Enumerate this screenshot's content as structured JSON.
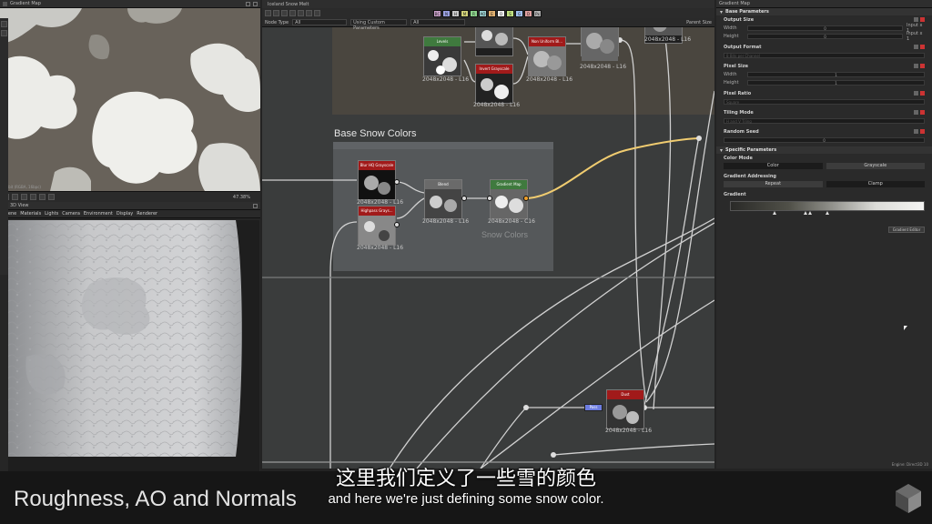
{
  "left_top_panel": {
    "title": "Gradient Map",
    "status": "16bit (RGBA, 16bpc)",
    "zoom": "47.38%"
  },
  "view3d": {
    "title": "3D View",
    "menu": [
      "Scene",
      "Materials",
      "Lights",
      "Camera",
      "Environment",
      "Display",
      "Renderer"
    ]
  },
  "graph": {
    "title": "Iceland Snow Melt",
    "node_type_label": "Node Type",
    "node_type_value": "All",
    "params_value": "Using Custom Parameters",
    "params_value2": "All",
    "parent_size": "Parent Size",
    "chips": [
      {
        "label": "BC",
        "color": "#c8a0c8"
      },
      {
        "label": "N",
        "color": "#9aa0e0"
      },
      {
        "label": "H",
        "color": "#c9c9c9"
      },
      {
        "label": "M",
        "color": "#d2d27a"
      },
      {
        "label": "R",
        "color": "#8bd28b"
      },
      {
        "label": "AO",
        "color": "#9ad0d0"
      },
      {
        "label": "E",
        "color": "#e0b070"
      },
      {
        "label": "O",
        "color": "#f0f0f0"
      },
      {
        "label": "S",
        "color": "#c0e080"
      },
      {
        "label": "G",
        "color": "#a0c0f0"
      },
      {
        "label": "D",
        "color": "#e0a0a0"
      },
      {
        "label": "Px",
        "color": "#b0b0b0"
      }
    ],
    "frame_title": "Base Snow Colors",
    "frame_caption": "Snow Colors",
    "nodes": {
      "levels": {
        "title": "Levels",
        "caption": "2048x2048 - L16"
      },
      "tl2": {
        "title": "",
        "caption": "2048x2048 - L16"
      },
      "nonuniform": {
        "title": "Non Uniform Bl...",
        "caption": "2048x2048 - L16"
      },
      "invert": {
        "title": "Invert Grayscale",
        "caption": "2048x2048 - L16"
      },
      "tr": {
        "title": "",
        "caption": "2048x2048 - L16"
      },
      "far": {
        "title": "",
        "caption": "2048x2048 - L16"
      },
      "blur": {
        "title": "Blur HQ Grayscale",
        "caption": "2048x2048 - L16"
      },
      "highpass": {
        "title": "Highpass Grays...",
        "caption": "2048x2048 - L16"
      },
      "blend": {
        "title": "Blend",
        "caption": "2048x2048 - L16"
      },
      "gradient": {
        "title": "Gradient Map",
        "caption": "2048x2048 - C16"
      },
      "dust": {
        "title": "Dust",
        "caption": "2048x2048 - L16"
      }
    },
    "blue_node": "Pass"
  },
  "properties": {
    "title": "Gradient Map",
    "base_section": "Base Parameters",
    "output_size": "Output Size",
    "width_label": "Width",
    "height_label": "Height",
    "width_val": "0",
    "height_val": "0",
    "input_x1": "Input x 1",
    "output_format": "Output Format",
    "output_format_val": "8 Bits per Channel",
    "pixel_size": "Pixel Size",
    "ps_width": "1",
    "ps_height": "1",
    "pixel_ratio": "Pixel Ratio",
    "pixel_ratio_val": "Square",
    "tiling_mode": "Tiling Mode",
    "tiling_val": "H and V Tiling",
    "random_seed": "Random Seed",
    "random_seed_val": "0",
    "specific_section": "Specific Parameters",
    "color_mode": "Color Mode",
    "color_btn": "Color",
    "grayscale_btn": "Grayscale",
    "gradient_addressing": "Gradient Addressing",
    "repeat_btn": "Repeat",
    "clamp_btn": "Clamp",
    "gradient_label": "Gradient",
    "gradient_editor": "Gradient Editor",
    "engine": "Engine: Direct3D 10"
  },
  "banner": {
    "title": "Roughness, AO and Normals"
  },
  "subtitles": {
    "cn": "这里我们定义了一些雪的颜色",
    "en": "and here we're just defining some snow color."
  }
}
